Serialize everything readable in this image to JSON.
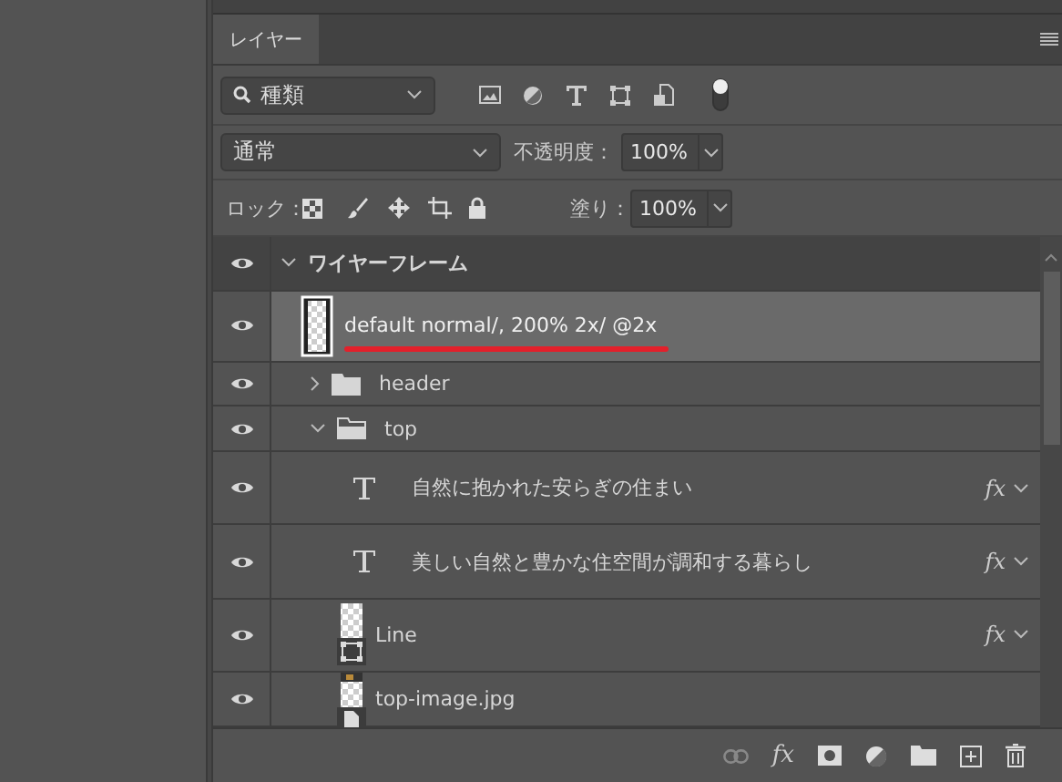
{
  "tab": {
    "label": "レイヤー",
    "selected": true
  },
  "filter": {
    "value": "種類"
  },
  "blend_mode": {
    "value": "通常"
  },
  "opacity": {
    "label": "不透明度：",
    "value": "100%"
  },
  "lock": {
    "label": "ロック："
  },
  "fill": {
    "label": "塗り：",
    "value": "100%"
  },
  "layers": [
    {
      "kind": "group",
      "name": "ワイヤーフレーム",
      "visible": true,
      "selected": false,
      "expanded": true,
      "children": [
        {
          "kind": "layer",
          "name": "default normal/, 200% 2x/ @2x",
          "visible": true,
          "selected": true,
          "underlined": true
        },
        {
          "kind": "group",
          "name": "header",
          "visible": true,
          "selected": false,
          "expanded": false
        },
        {
          "kind": "group",
          "name": "top",
          "visible": true,
          "selected": false,
          "expanded": true,
          "children": [
            {
              "kind": "text",
              "name": "自然に抱かれた安らぎの住まい",
              "visible": true,
              "selected": false,
              "effects": "fx"
            },
            {
              "kind": "text",
              "name": "美しい自然と豊かな住空間が調和する暮らし",
              "visible": true,
              "selected": false,
              "effects": "fx"
            },
            {
              "kind": "shape",
              "name": "Line",
              "visible": true,
              "selected": false,
              "effects": "fx"
            },
            {
              "kind": "image",
              "name": "top-image.jpg",
              "visible": true,
              "selected": false
            }
          ]
        }
      ]
    }
  ],
  "footer": {
    "effects_label": "fx"
  }
}
